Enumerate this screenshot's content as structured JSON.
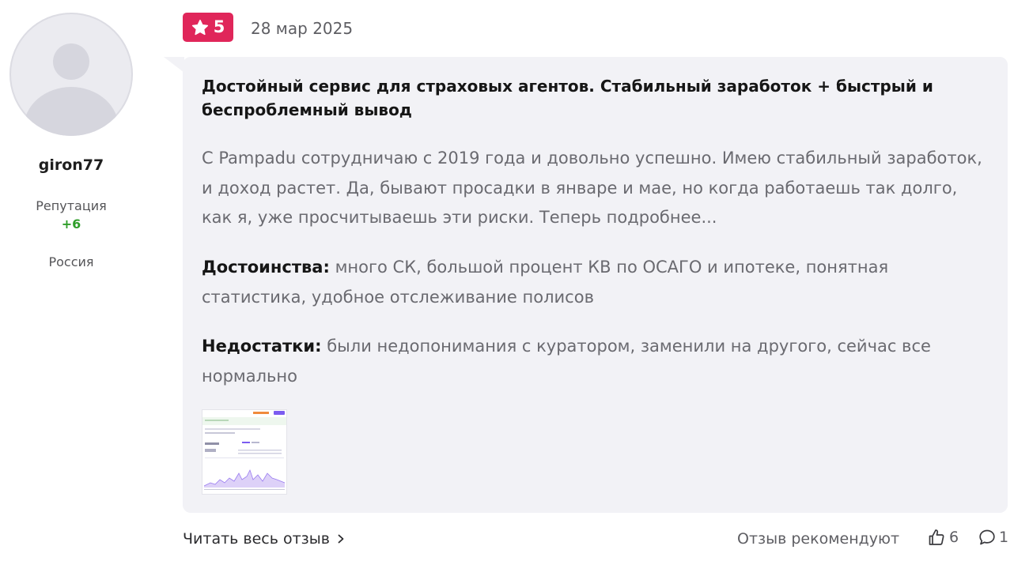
{
  "author": {
    "username": "giron77",
    "reputation_label": "Репутация",
    "reputation_value": "+6",
    "country": "Россия"
  },
  "review": {
    "rating": "5",
    "date": "28 мар 2025",
    "title": "Достойный сервис для страховых агентов. Стабильный заработок + быстрый и беспроблемный вывод",
    "text": "С Pampadu сотрудничаю с 2019 года и довольно успешно. Имею стабильный заработок, и доход растет. Да, бывают просадки в январе и мае, но когда работаешь так долго, как я, уже просчитываешь эти риски. Теперь подробнее...",
    "pros_label": "Достоинства:",
    "pros": "много СК, большой процент КВ по ОСАГО и ипотеке, понятная статистика, удобное отслеживание полисов",
    "cons_label": "Недостатки:",
    "cons": "были недопонимания с куратором, заменили на другого, сейчас все нормально"
  },
  "footer": {
    "read_more": "Читать весь отзыв",
    "recommend_label": "Отзыв рекомендуют",
    "likes": "6",
    "comments": "1"
  },
  "icons": {
    "rating": "star-icon",
    "read_more": "chevron-right-icon",
    "likes": "thumbs-up-icon",
    "comments": "comment-icon",
    "avatar": "default-user-icon"
  },
  "colors": {
    "rating_badge": "#e0265a",
    "reputation": "#2f9e2a",
    "bubble_bg": "#f2f2f6"
  }
}
